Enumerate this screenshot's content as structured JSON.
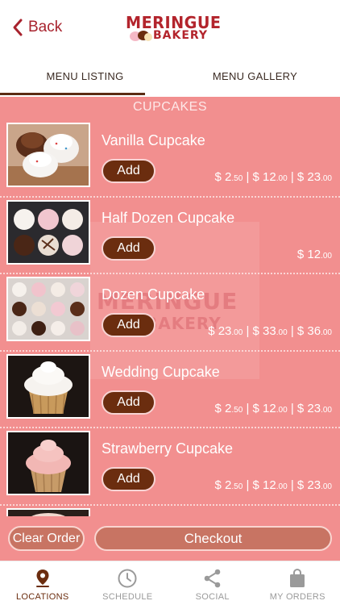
{
  "header": {
    "back_label": "Back",
    "logo_line1": "MERINGUE",
    "logo_line2": "BAKERY"
  },
  "tabs": [
    {
      "label": "MENU LISTING",
      "active": true
    },
    {
      "label": "MENU GALLERY",
      "active": false
    }
  ],
  "section_title": "CUPCAKES",
  "items": [
    {
      "name": "Vanilla Cupcake",
      "add_label": "Add",
      "price": [
        {
          "d": "$ 2",
          "c": ".50"
        },
        {
          "d": " | $ 12",
          "c": ".00"
        },
        {
          "d": " | $ 23",
          "c": ".00"
        }
      ]
    },
    {
      "name": "Half Dozen Cupcake",
      "add_label": "Add",
      "price": [
        {
          "d": "$ 12",
          "c": ".00"
        }
      ]
    },
    {
      "name": "Dozen Cupcake",
      "add_label": "Add",
      "price": [
        {
          "d": "$ 23",
          "c": ".00"
        },
        {
          "d": " | $ 33",
          "c": ".00"
        },
        {
          "d": " | $ 36",
          "c": ".00"
        }
      ]
    },
    {
      "name": "Wedding Cupcake",
      "add_label": "Add",
      "price": [
        {
          "d": "$ 2",
          "c": ".50"
        },
        {
          "d": " | $ 12",
          "c": ".00"
        },
        {
          "d": " | $ 23",
          "c": ".00"
        }
      ]
    },
    {
      "name": "Strawberry Cupcake",
      "add_label": "Add",
      "price": [
        {
          "d": "$ 2",
          "c": ".50"
        },
        {
          "d": " | $ 12",
          "c": ".00"
        },
        {
          "d": " | $ 23",
          "c": ".00"
        }
      ]
    }
  ],
  "order_bar": {
    "clear_label": "Clear Order",
    "checkout_label": "Checkout"
  },
  "tabbar": [
    {
      "label": "LOCATIONS",
      "icon": "location-pin-icon",
      "active": true
    },
    {
      "label": "SCHEDULE",
      "icon": "clock-icon",
      "active": false
    },
    {
      "label": "SOCIAL",
      "icon": "share-icon",
      "active": false
    },
    {
      "label": "MY ORDERS",
      "icon": "shopping-bag-icon",
      "active": false
    }
  ],
  "colors": {
    "brand_red": "#b3242c",
    "list_background": "#f28f8f",
    "add_button": "#6b2d0f",
    "order_button": "#c87463"
  }
}
